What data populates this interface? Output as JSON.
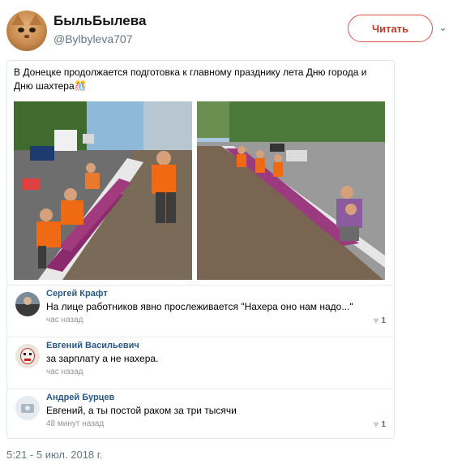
{
  "profile": {
    "display_name": "БыльБылева",
    "handle": "@Bylbyleva707",
    "avatar_icon": "cat-avatar-icon"
  },
  "actions": {
    "read_label": "Читать",
    "more_icon": "chevron-down-icon"
  },
  "post": {
    "text": "В Донецке продолжается подготовка к главному празднику лета Дню города и Дню шахтера🎊",
    "photos": [
      "workers-planting-flowers-photo-1",
      "workers-planting-flowers-photo-2"
    ]
  },
  "comments": [
    {
      "author": "Сергей Крафт",
      "text": "На лице работников явно прослеживается \"Нахера оно нам надо...\"",
      "time": "час назад",
      "likes": "1"
    },
    {
      "author": "Евгений Васильевич",
      "text": "за зарплату а не нахера.",
      "time": "час назад",
      "likes": ""
    },
    {
      "author": "Андрей Бурцев",
      "text": "Евгений, а ты постой раком за три тысячи",
      "time": "48 минут назад",
      "likes": "1"
    }
  ],
  "tweet_timestamp": "5:21 - 5 июл. 2018 г.",
  "colors": {
    "accent_red": "#d9534f",
    "link_blue": "#2a5885",
    "muted_gray": "#657786"
  }
}
